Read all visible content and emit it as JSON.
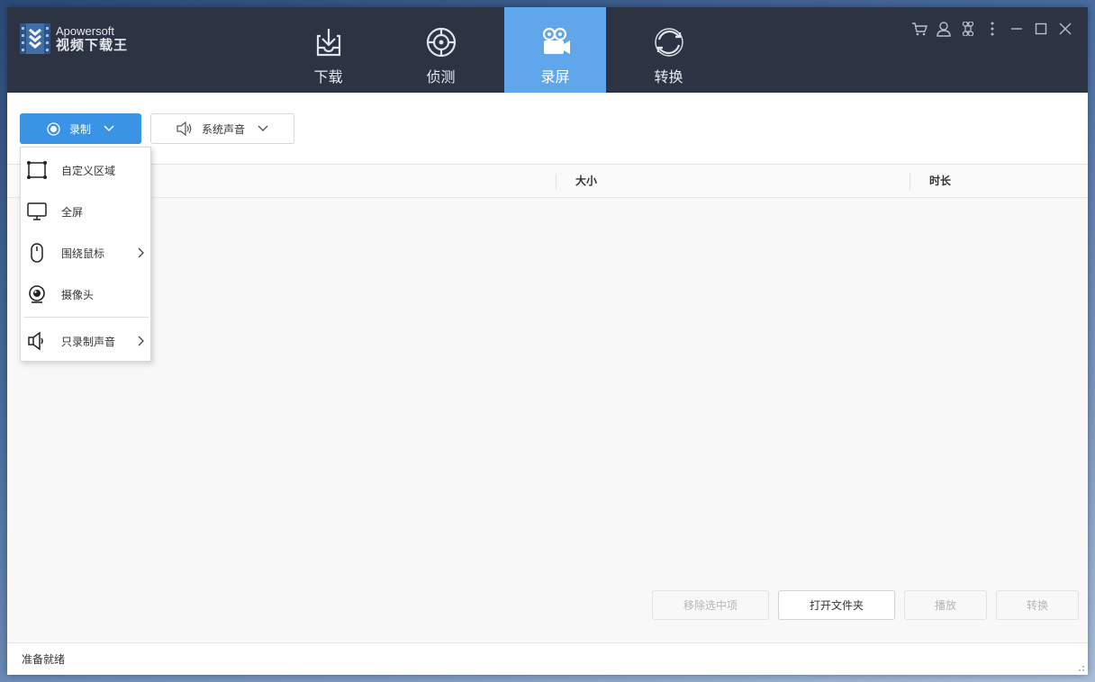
{
  "header": {
    "brand": "Apowersoft",
    "app_name": "视频下载王",
    "tabs": [
      {
        "label": "下载",
        "icon": "download-icon"
      },
      {
        "label": "侦测",
        "icon": "detect-icon"
      },
      {
        "label": "录屏",
        "icon": "camera-icon"
      },
      {
        "label": "转换",
        "icon": "convert-icon"
      }
    ],
    "active_tab": "录屏",
    "window_controls": [
      "cart-icon",
      "user-icon",
      "command-icon",
      "more-icon",
      "minimize-icon",
      "maximize-icon",
      "close-icon"
    ]
  },
  "toolbar": {
    "record_label": "录制",
    "audio_label": "系统声音"
  },
  "table": {
    "columns": [
      "大小",
      "时长"
    ]
  },
  "record_menu": {
    "items": [
      {
        "label": "自定义区域",
        "icon": "custom-region-icon",
        "has_submenu": false
      },
      {
        "label": "全屏",
        "icon": "monitor-icon",
        "has_submenu": false
      },
      {
        "label": "围绕鼠标",
        "icon": "mouse-icon",
        "has_submenu": true
      },
      {
        "label": "摄像头",
        "icon": "webcam-icon",
        "has_submenu": false
      },
      {
        "label": "只录制声音",
        "icon": "speaker-icon",
        "has_submenu": true
      }
    ]
  },
  "actions": {
    "remove_selected": "移除选中项",
    "open_folder": "打开文件夹",
    "play": "播放",
    "convert": "转换"
  },
  "status": {
    "text": "准备就绪"
  },
  "colors": {
    "header_bg": "#2c3343",
    "active_tab": "#5fa6ea",
    "record_button": "#3a93e5"
  }
}
